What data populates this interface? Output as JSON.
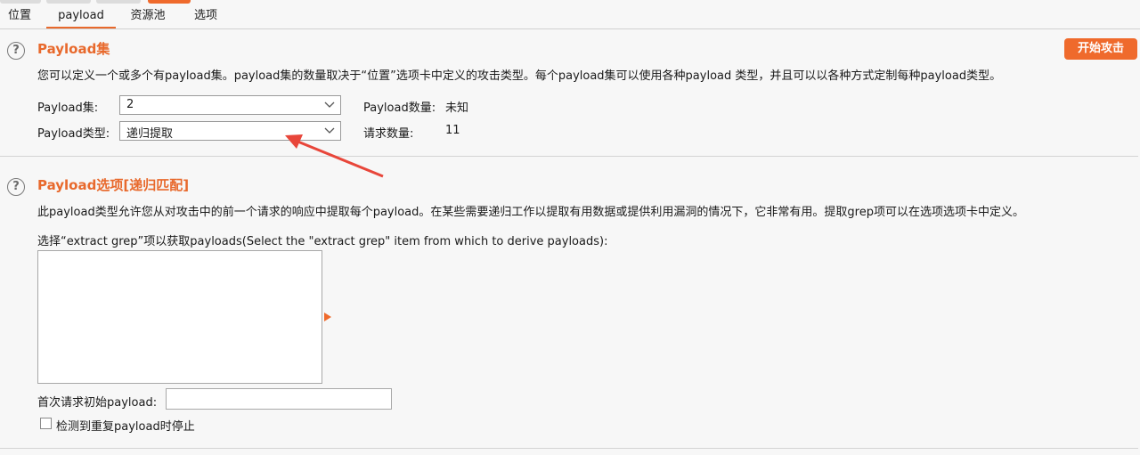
{
  "tabs": [
    {
      "label": "位置"
    },
    {
      "label": "payload"
    },
    {
      "label": "资源池"
    },
    {
      "label": "选项"
    }
  ],
  "payload_sets": {
    "title": "Payload集",
    "description": "您可以定义一个或多个有payload集。payload集的数量取决于“位置”选项卡中定义的攻击类型。每个payload集可以使用各种payload 类型，并且可以以各种方式定制每种payload类型。",
    "start_attack_label": "开始攻击",
    "set_label": "Payload集:",
    "set_value": "2",
    "type_label": "Payload类型:",
    "type_value": "递归提取",
    "count_label": "Payload数量:",
    "count_value": "未知",
    "requests_label": "请求数量:",
    "requests_value": "11"
  },
  "payload_options": {
    "title": "Payload选项[递归匹配]",
    "description": "此payload类型允许您从对攻击中的前一个请求的响应中提取每个payload。在某些需要递归工作以提取有用数据或提供利用漏洞的情况下，它非常有用。提取grep项可以在选项选项卡中定义。",
    "grep_prompt": "选择“extract grep”项以获取payloads(Select the \"extract grep\" item from which to derive payloads):",
    "initial_payload_label": "首次请求初始payload:",
    "initial_payload_value": "",
    "stop_on_duplicate_label": "检测到重复payload时停止",
    "stop_on_duplicate_checked": false
  },
  "colors": {
    "accent": "#e8692c",
    "button": "#ef6a2c",
    "annotation_arrow": "#e8463a"
  },
  "icons": {
    "help": "question-circle-icon",
    "dropdown": "chevron-down-icon"
  }
}
